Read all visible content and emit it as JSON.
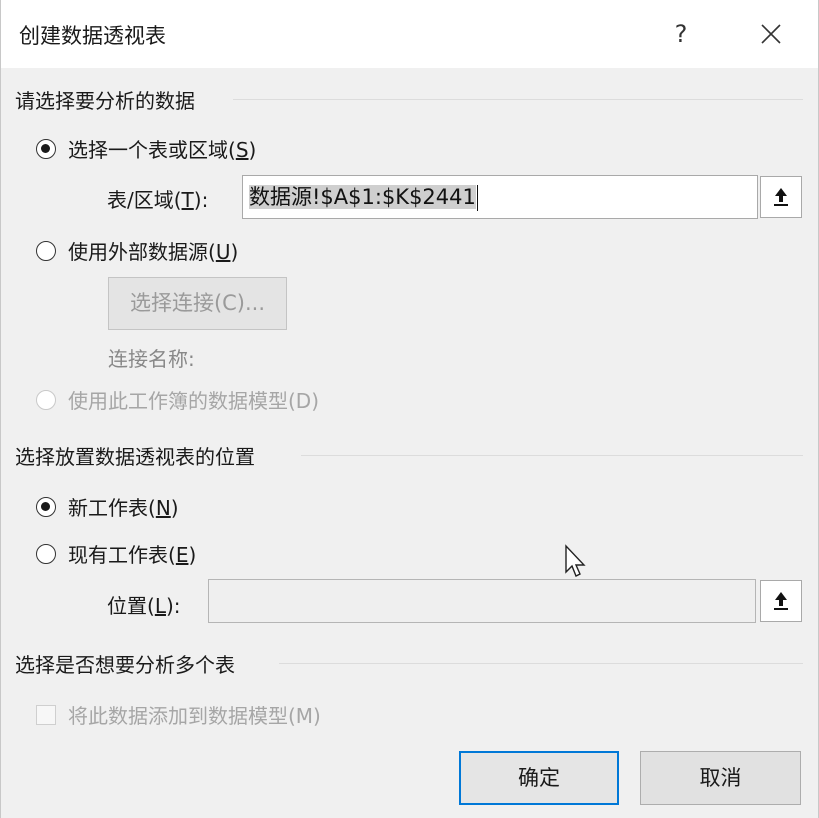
{
  "dialog": {
    "title": "创建数据透视表",
    "help_label": "?"
  },
  "source_section": {
    "title": "请选择要分析的数据",
    "option_table": {
      "label_prefix": "选择一个表或区域(",
      "hotkey": "S",
      "label_suffix": ")",
      "checked": true
    },
    "range_field": {
      "label_prefix": "表/区域(",
      "hotkey": "T",
      "label_suffix": "):",
      "value": "数据源!$A$1:$K$2441"
    },
    "option_external": {
      "label_prefix": "使用外部数据源(",
      "hotkey": "U",
      "label_suffix": ")",
      "checked": false
    },
    "choose_connection_label": "选择连接(C)...",
    "connection_name_label": "连接名称:",
    "option_model": {
      "label": "使用此工作簿的数据模型(D)",
      "enabled": false
    }
  },
  "placement_section": {
    "title": "选择放置数据透视表的位置",
    "option_new": {
      "label_prefix": "新工作表(",
      "hotkey": "N",
      "label_suffix": ")",
      "checked": true
    },
    "option_existing": {
      "label_prefix": "现有工作表(",
      "hotkey": "E",
      "label_suffix": ")",
      "checked": false
    },
    "location_field": {
      "label_prefix": "位置(",
      "hotkey": "L",
      "label_suffix": "):",
      "value": ""
    }
  },
  "multi_section": {
    "title": "选择是否想要分析多个表",
    "add_to_model": {
      "label": "将此数据添加到数据模型(M)",
      "checked": false,
      "enabled": false
    }
  },
  "buttons": {
    "ok_label": "确定",
    "cancel_label": "取消"
  },
  "colors": {
    "accent": "#0078d7",
    "disabled_text": "#a6a6a6"
  }
}
